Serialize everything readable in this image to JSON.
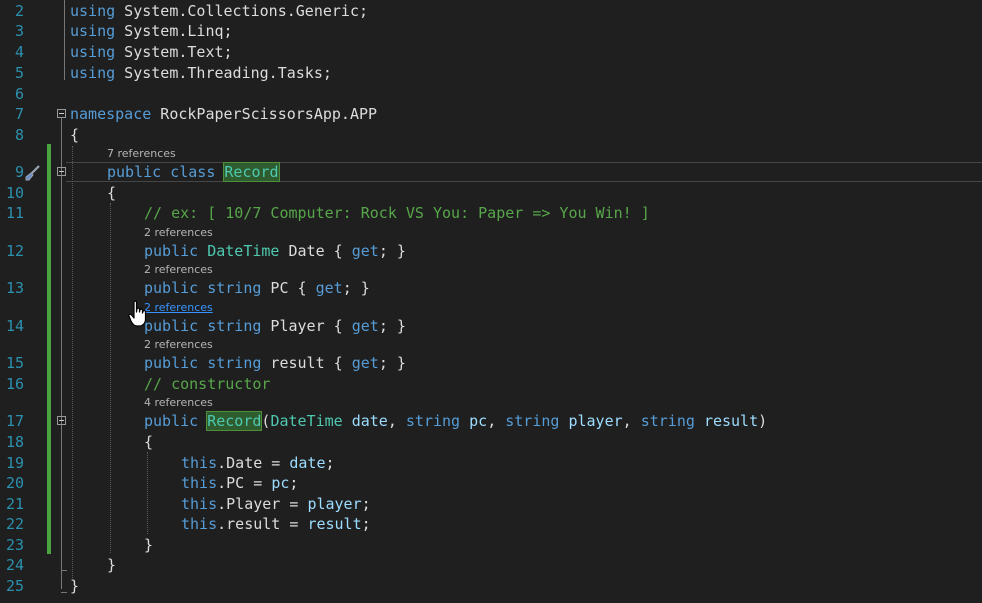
{
  "line_numbers": [
    "2",
    "3",
    "4",
    "5",
    "6",
    "7",
    "8",
    "9",
    "10",
    "11",
    "12",
    "13",
    "14",
    "15",
    "16",
    "17",
    "18",
    "19",
    "20",
    "21",
    "22",
    "23",
    "24",
    "25"
  ],
  "code": {
    "using1": {
      "kw": "using",
      "rest": " System.Collections.Generic;"
    },
    "using2": {
      "kw": "using",
      "rest": " System.Linq;"
    },
    "using3": {
      "kw": "using",
      "rest": " System.Text;"
    },
    "using4": {
      "kw": "using",
      "rest": " System.Threading.Tasks;"
    },
    "ns": {
      "kw": "namespace",
      "name": " RockPaperScissorsApp.APP"
    },
    "open_brace": "{",
    "close_brace": "}",
    "class_kw1": "public",
    "class_kw2": "class",
    "class_name": "Record",
    "comment1": "// ex: [ 10/7 Computer: Rock VS You: Paper => You Win! ]",
    "comment2": "// constructor",
    "public": "public",
    "get": "get",
    "string": "string",
    "datetime": "DateTime",
    "prop_date": " Date { ",
    "prop_pc": " PC { ",
    "prop_player": " Player { ",
    "prop_result": " result { ",
    "prop_end": "; }",
    "ctor_name": "Record",
    "p_date": "date",
    "p_pc": "pc",
    "p_player": "player",
    "p_result": "result",
    "this": "this",
    "assign_date": ".Date = ",
    "assign_pc": ".PC = ",
    "assign_player": ".Player = ",
    "assign_result": ".result = ",
    "semi": ";"
  },
  "codelens": {
    "class_refs": "7 references",
    "date_refs": "2 references",
    "pc_refs": "2 references",
    "player_refs": "2 references",
    "result_refs": "2 references",
    "ctor_refs": "4 references"
  },
  "icons": [
    "brush-icon",
    "hand-cursor-icon",
    "collapse-icon"
  ],
  "colors": {
    "background": "#1f1f1f",
    "keyword": "#569cd6",
    "type": "#4ec9b0",
    "comment": "#57a64a",
    "line_number": "#2b91af",
    "change_bar": "#4aa240"
  }
}
